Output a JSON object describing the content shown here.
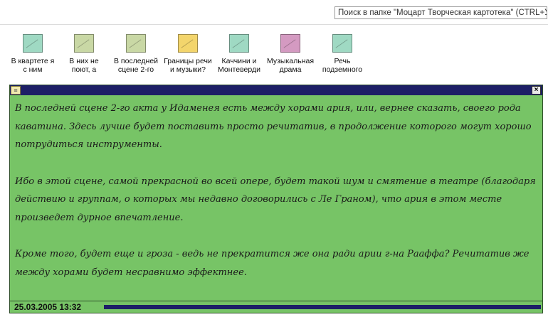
{
  "search": {
    "placeholder": "Поиск в папке \"Моцарт Творческая картотека\" (CTRL+У)"
  },
  "notes": [
    {
      "line1": "В квартете я",
      "line2": "с ним",
      "color": "#9fd9c3"
    },
    {
      "line1": "В них не",
      "line2": "поют, а",
      "color": "#c9d8a5"
    },
    {
      "line1": "В последней",
      "line2": "сцене 2-го",
      "color": "#c9d8a5"
    },
    {
      "line1": "Границы речи",
      "line2": "и музыки?",
      "color": "#f3d56c"
    },
    {
      "line1": "Каччини и",
      "line2": "Монтеверди",
      "color": "#9fd9c3"
    },
    {
      "line1": "Музыкальная",
      "line2": "драма",
      "color": "#d49ac1"
    },
    {
      "line1": "Речь",
      "line2": "подземного",
      "color": "#9fd9c3"
    }
  ],
  "note_window": {
    "background": "#77c466",
    "paragraphs": [
      "В последней сцене 2-го акта у Идаменея есть между хорами ария, или, вернее сказать, своего рода каватина. Здесь лучше будет поставить просто речитатив, в продолжение которого могут хорошо потрудиться инструменты.",
      "Ибо в этой сцене, самой прекрасной во всей опере, будет такой шум и смятение в театре (благодаря действию и группам, о которых мы недавно договорились с Ле Граном), что ария в этом месте произведет дурное впечатление.",
      "Кроме того, будет еще и гроза - ведь не прекратится же она ради арии г-на Рааффа? Речитатив же между хорами будет несравнимо эффектнее."
    ],
    "date": "25.03.2005 13:32",
    "close_label": "×",
    "title_icon": "note-icon"
  }
}
